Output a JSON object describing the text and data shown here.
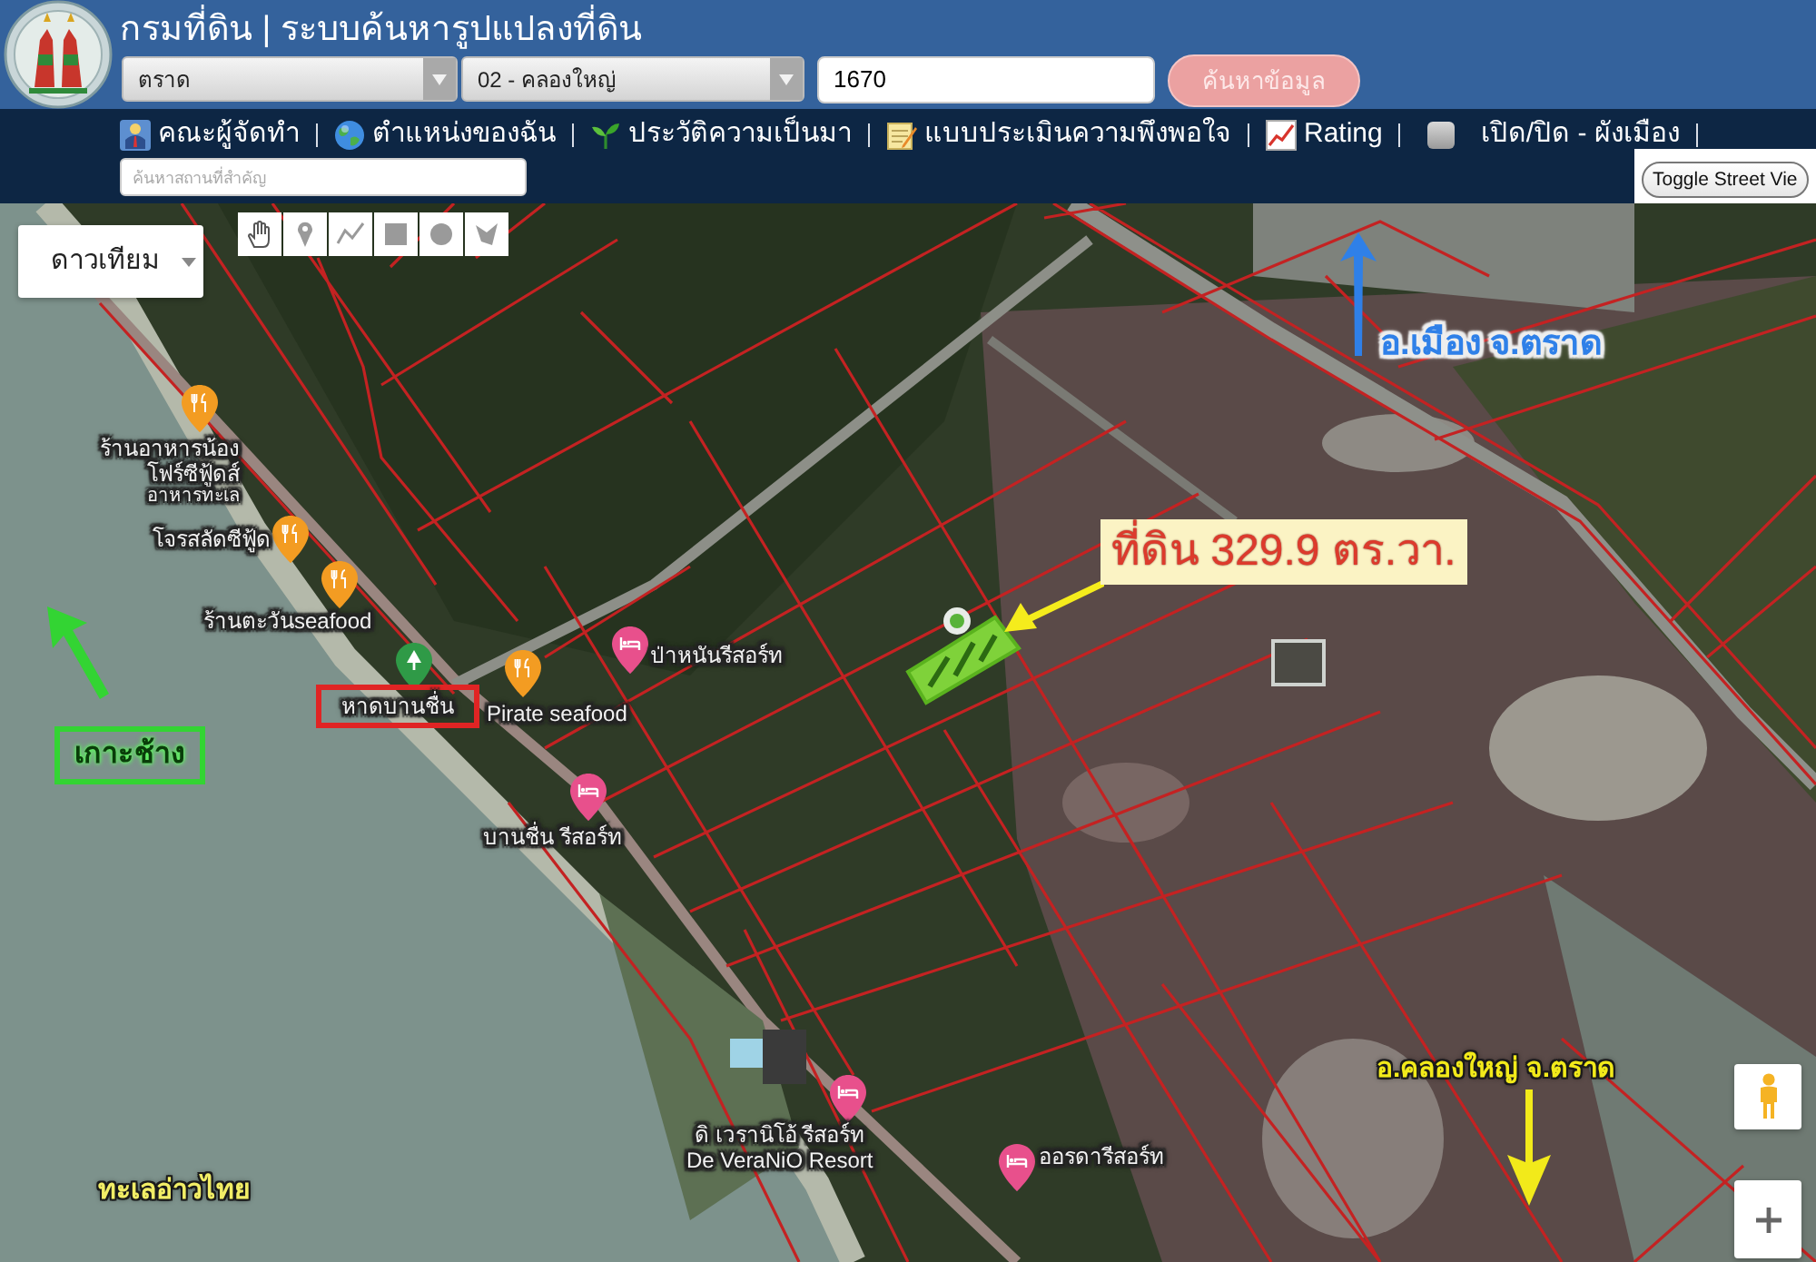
{
  "header": {
    "title": "กรมที่ดิน | ระบบค้นหารูปแปลงที่ดิน",
    "province_select": {
      "value": "ตราด"
    },
    "district_select": {
      "value": "02 - คลองใหญ่"
    },
    "parcel_number_field": {
      "value": "1670"
    },
    "search_button": {
      "label": "ค้นหาข้อมูล"
    }
  },
  "nav": {
    "links": [
      {
        "label": "คณะผู้จัดทำ"
      },
      {
        "label": "ตำแหน่งของฉัน"
      },
      {
        "label": "ประวัติความเป็นมา"
      },
      {
        "label": "แบบประเมินความพึงพอใจ"
      },
      {
        "label": "Rating"
      }
    ],
    "city_plan_toggle": {
      "label": "เปิด/ปิด - ผังเมือง",
      "checked": false
    },
    "place_search": {
      "placeholder": "ค้นหาสถานที่สำคัญ"
    },
    "street_view_toggle": {
      "label": "Toggle Street Vie"
    }
  },
  "map": {
    "type_control": {
      "label": "ดาวเทียม"
    },
    "places": [
      {
        "kind": "restaurant",
        "lines": [
          "ร้านอาหารน้อง",
          "โฟร์ซีฟู้ดส์"
        ],
        "category": "อาหารทะเล",
        "highlighted": false
      },
      {
        "kind": "restaurant",
        "lines": [
          "โจรสลัดซีฟู้ด"
        ],
        "highlighted": false
      },
      {
        "kind": "restaurant",
        "lines": [
          "ร้านตะวันseafood"
        ],
        "highlighted": false
      },
      {
        "kind": "park",
        "lines": [
          "หาดบานชื่น"
        ],
        "highlighted": true
      },
      {
        "kind": "restaurant",
        "lines": [
          "Pirate seafood"
        ],
        "highlighted": false
      },
      {
        "kind": "hotel",
        "lines": [
          "ป่าหนันรีสอร์ท"
        ],
        "highlighted": false
      },
      {
        "kind": "hotel",
        "lines": [
          "บานชื่น รีสอร์ท"
        ],
        "highlighted": false
      },
      {
        "kind": "hotel",
        "lines": [
          "ดิ เวรานิโอ้ รีสอร์ท",
          "De VeraNiO Resort"
        ],
        "highlighted": false
      },
      {
        "kind": "hotel",
        "lines": [
          "ออรดารีสอร์ท"
        ],
        "highlighted": false
      }
    ],
    "annotations": [
      {
        "kind": "arrow-label",
        "text": "อ.เมือง จ.ตราด",
        "color": "#2f80e8"
      },
      {
        "kind": "callout",
        "text": "ที่ดิน 329.9 ตร.วา.",
        "color": "#f5ec1c"
      },
      {
        "kind": "arrow-label",
        "text": "อ.คลองใหญ่ จ.ตราด",
        "color": "#f2ea1a"
      },
      {
        "kind": "boxed-label",
        "text": "เกาะช้าง",
        "color": "#33d433"
      },
      {
        "kind": "label",
        "text": "ทะเลอ่าวไทย"
      }
    ]
  }
}
